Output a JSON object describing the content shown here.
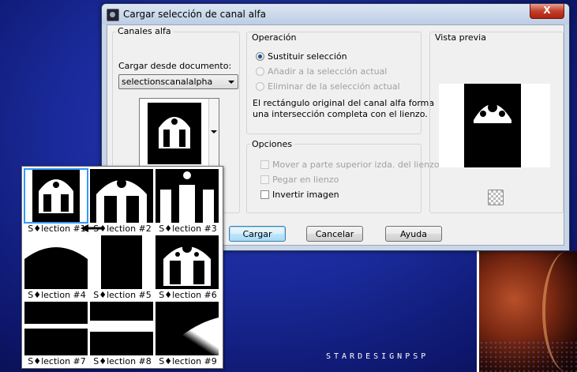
{
  "window": {
    "title": "Cargar selección de canal alfa",
    "close_label": "X"
  },
  "canales": {
    "group_label": "Canales alfa",
    "doc_label": "Cargar desde documento:",
    "doc_value": "selectionscanalalpha"
  },
  "operacion": {
    "group_label": "Operación",
    "options": [
      "Sustituir selección",
      "Añadir a la selección actual",
      "Eliminar de la selección actual"
    ],
    "selected": "Sustituir selección",
    "note_line1": "El rectángulo original del canal alfa forma",
    "note_line2": "una intersección completa con el lienzo."
  },
  "opciones": {
    "group_label": "Opciones",
    "items": [
      "Mover a parte superior izda. del lienzo",
      "Pegar en lienzo",
      "Invertir imagen"
    ]
  },
  "preview": {
    "group_label": "Vista previa"
  },
  "buttons": {
    "ok": "Cargar",
    "cancel": "Cancelar",
    "help": "Ayuda"
  },
  "thumbnails": [
    {
      "label": "S♦lection #1",
      "selected": true
    },
    {
      "label": "S♦lection #2",
      "selected": false
    },
    {
      "label": "S♦lection #3",
      "selected": false
    },
    {
      "label": "S♦lection #4",
      "selected": false
    },
    {
      "label": "S♦lection #5",
      "selected": false
    },
    {
      "label": "S♦lection #6",
      "selected": false
    },
    {
      "label": "S♦lection #7",
      "selected": false
    },
    {
      "label": "S♦lection #8",
      "selected": false
    },
    {
      "label": "S♦lection #9",
      "selected": false
    }
  ],
  "watermark": "STARDESIGNPSP",
  "colors": {
    "accent": "#3399ff",
    "desktop": "#1a2a9a"
  }
}
